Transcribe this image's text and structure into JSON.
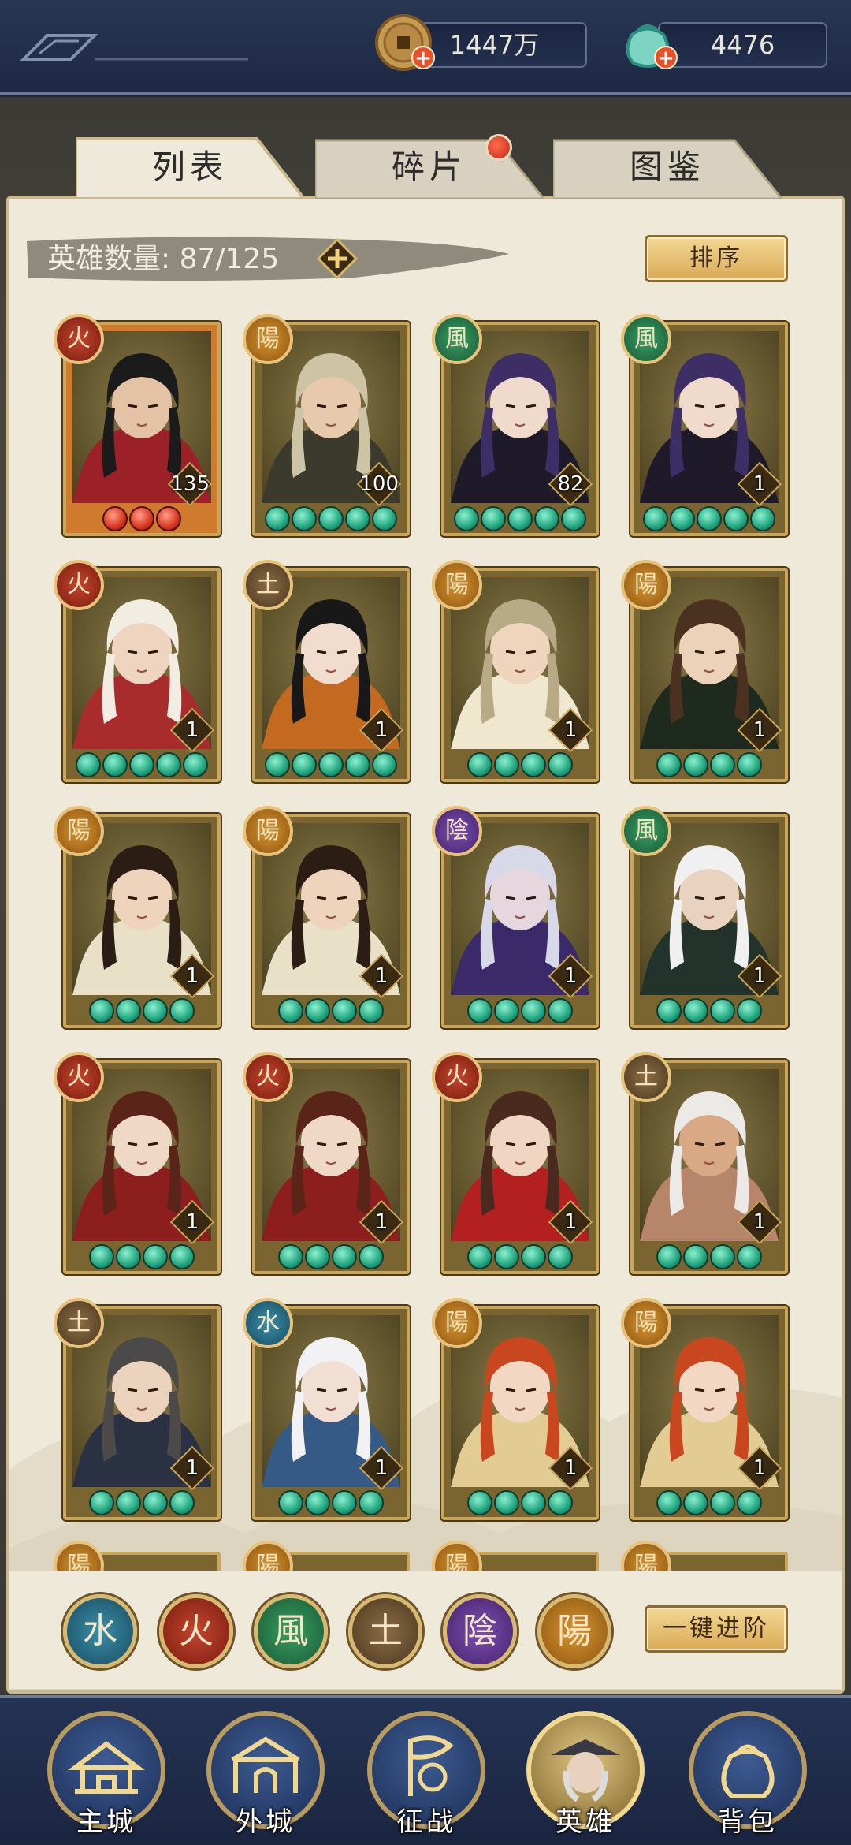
{
  "currency": {
    "gold_amount": "1447万",
    "jade_amount": "4476",
    "plus_symbol": "+"
  },
  "tabs": [
    {
      "label": "列表",
      "active": true
    },
    {
      "label": "碎片",
      "active": false
    },
    {
      "label": "图鉴",
      "active": false
    }
  ],
  "hero_count": {
    "label": "英雄数量: 87/125",
    "plus_symbol": "+"
  },
  "buttons": {
    "sort": "排序",
    "one_key_advance": "一键进阶"
  },
  "heroes": [
    {
      "element": "火",
      "type": "fire",
      "level": "135",
      "stars": 3,
      "star_color": "red",
      "hair": "#1b1b1b",
      "outfit": "#9c2027",
      "skin": "#e3c2a6"
    },
    {
      "element": "陽",
      "type": "yang",
      "level": "100",
      "stars": 5,
      "star_color": "green",
      "hair": "#cdc3a5",
      "outfit": "#3b3a2c",
      "skin": "#e7c9ad"
    },
    {
      "element": "風",
      "type": "wind",
      "level": "82",
      "stars": 5,
      "star_color": "green",
      "hair": "#3e2e66",
      "outfit": "#1f1a2a",
      "skin": "#f0dacb"
    },
    {
      "element": "風",
      "type": "wind",
      "level": "1",
      "stars": 5,
      "star_color": "green",
      "hair": "#3e2e66",
      "outfit": "#1f1a2a",
      "skin": "#f0dacb"
    },
    {
      "element": "火",
      "type": "fire",
      "level": "1",
      "stars": 5,
      "star_color": "green",
      "hair": "#f1ede3",
      "outfit": "#a82c2c",
      "skin": "#efd4c0"
    },
    {
      "element": "土",
      "type": "earth",
      "level": "1",
      "stars": 5,
      "star_color": "green",
      "hair": "#181818",
      "outfit": "#c36a20",
      "skin": "#f1dccd"
    },
    {
      "element": "陽",
      "type": "yang",
      "level": "1",
      "stars": 4,
      "star_color": "green",
      "hair": "#b8a987",
      "outfit": "#f0e7cf",
      "skin": "#efd5bd"
    },
    {
      "element": "陽",
      "type": "yang",
      "level": "1",
      "stars": 4,
      "star_color": "green",
      "hair": "#4b3220",
      "outfit": "#1f2a1e",
      "skin": "#ecd2b8"
    },
    {
      "element": "陽",
      "type": "yang",
      "level": "1",
      "stars": 4,
      "star_color": "green",
      "hair": "#2b1d14",
      "outfit": "#e8e0c7",
      "skin": "#efd4bd"
    },
    {
      "element": "陽",
      "type": "yang",
      "level": "1",
      "stars": 4,
      "star_color": "green",
      "hair": "#2b1d14",
      "outfit": "#e8e0c7",
      "skin": "#efd4bd"
    },
    {
      "element": "陰",
      "type": "yin",
      "level": "1",
      "stars": 4,
      "star_color": "green",
      "hair": "#d7d9e8",
      "outfit": "#3a2a6a",
      "skin": "#e6d6dd"
    },
    {
      "element": "風",
      "type": "wind",
      "level": "1",
      "stars": 4,
      "star_color": "green",
      "hair": "#f0f0f0",
      "outfit": "#22332c",
      "skin": "#e9d2c0"
    },
    {
      "element": "火",
      "type": "fire",
      "level": "1",
      "stars": 4,
      "star_color": "green",
      "hair": "#5a2418",
      "outfit": "#8c1e1e",
      "skin": "#f0d8c6"
    },
    {
      "element": "火",
      "type": "fire",
      "level": "1",
      "stars": 4,
      "star_color": "green",
      "hair": "#5a2418",
      "outfit": "#8c1e1e",
      "skin": "#f0d8c6"
    },
    {
      "element": "火",
      "type": "fire",
      "level": "1",
      "stars": 4,
      "star_color": "green",
      "hair": "#4a2a1e",
      "outfit": "#b41f1f",
      "skin": "#f0d5c2"
    },
    {
      "element": "土",
      "type": "earth",
      "level": "1",
      "stars": 4,
      "star_color": "green",
      "hair": "#ebeae6",
      "outfit": "#b7866a",
      "skin": "#d9a985"
    },
    {
      "element": "土",
      "type": "earth",
      "level": "1",
      "stars": 4,
      "star_color": "green",
      "hair": "#4b4a48",
      "outfit": "#2a3142",
      "skin": "#ecd3bd"
    },
    {
      "element": "水",
      "type": "water",
      "level": "1",
      "stars": 4,
      "star_color": "green",
      "hair": "#f2f2f4",
      "outfit": "#355a86",
      "skin": "#f1dfd4"
    },
    {
      "element": "陽",
      "type": "yang",
      "level": "1",
      "stars": 4,
      "star_color": "green",
      "hair": "#c8471f",
      "outfit": "#e2cc94",
      "skin": "#f2d8c2"
    },
    {
      "element": "陽",
      "type": "yang",
      "level": "1",
      "stars": 4,
      "star_color": "green",
      "hair": "#c8471f",
      "outfit": "#e2cc94",
      "skin": "#f2d8c2"
    }
  ],
  "partial_row": [
    {
      "element": "陽",
      "type": "yang"
    },
    {
      "element": "陽",
      "type": "yang"
    },
    {
      "element": "陽",
      "type": "yang"
    },
    {
      "element": "陽",
      "type": "yang"
    }
  ],
  "element_filters": [
    {
      "glyph": "水",
      "type": "water"
    },
    {
      "glyph": "火",
      "type": "fire"
    },
    {
      "glyph": "風",
      "type": "wind"
    },
    {
      "glyph": "土",
      "type": "earth"
    },
    {
      "glyph": "陰",
      "type": "yin"
    },
    {
      "glyph": "陽",
      "type": "yang"
    }
  ],
  "bottom_nav": [
    {
      "label": "主城",
      "icon": "palace-icon",
      "active": false
    },
    {
      "label": "外城",
      "icon": "city-gate-icon",
      "active": false
    },
    {
      "label": "征战",
      "icon": "battle-banner-icon",
      "active": false
    },
    {
      "label": "英雄",
      "icon": "hero-portrait-icon",
      "active": true
    },
    {
      "label": "背包",
      "icon": "bag-icon",
      "active": false
    }
  ],
  "colors": {
    "panel": "#efe9d9",
    "navy": "#1d2844",
    "gold_border": "#c9a45b",
    "jade_star": "#1fa47d",
    "red_star": "#d8351f"
  }
}
